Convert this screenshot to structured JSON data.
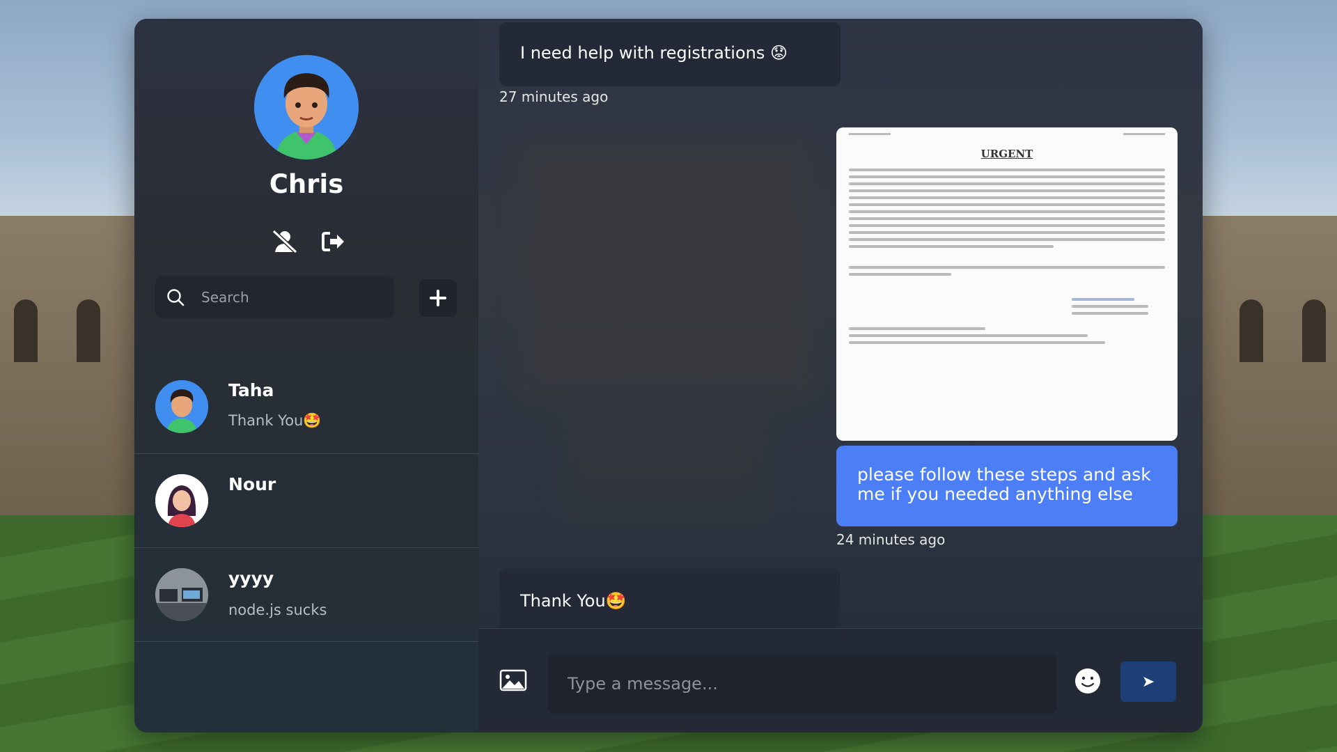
{
  "profile": {
    "name": "Chris",
    "actions": [
      {
        "icon": "user-slash-icon"
      },
      {
        "icon": "sign-out-icon"
      }
    ]
  },
  "search": {
    "placeholder": "Search",
    "add_icon": "plus-icon"
  },
  "contacts": [
    {
      "name": "Taha",
      "last_message": "Thank You🤩"
    },
    {
      "name": "Nour",
      "last_message": ""
    },
    {
      "name": "yyyy",
      "last_message": "node.js sucks"
    }
  ],
  "messages": [
    {
      "direction": "incoming",
      "text": "I need help with registrations 😟",
      "time": "27 minutes ago"
    },
    {
      "direction": "outgoing",
      "attachment": "document-image",
      "text": "please follow these steps and ask me if you needed anything else",
      "time": "24 minutes ago"
    },
    {
      "direction": "incoming",
      "text": "Thank You🤩"
    }
  ],
  "document": {
    "heading": "URGENT"
  },
  "composer": {
    "placeholder": "Type a message...",
    "image_icon": "image-icon",
    "emoji_icon": "smiley-icon",
    "send_label": "➤"
  },
  "colors": {
    "outgoing_bubble": "#4c7ff5",
    "incoming_bubble": "#232937",
    "send_button": "#1d3f77"
  }
}
